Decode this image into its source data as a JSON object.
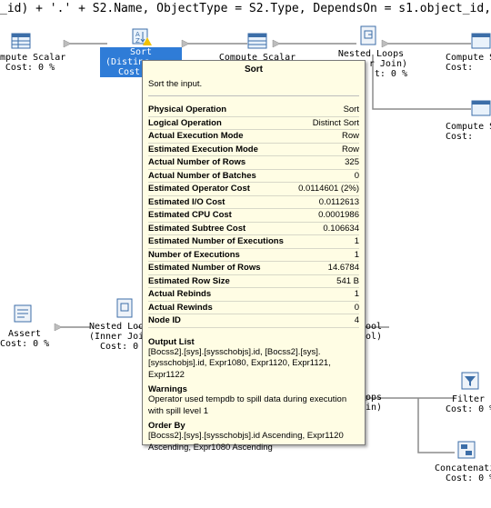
{
  "query_text": "_id) + '.' + S2.Name, ObjectType = S2.Type, DependsOn = s1.object_id, DependsOn",
  "operators": {
    "compute_scalar_left": {
      "name": "Compute Scalar",
      "cost": "Cost: 0 %"
    },
    "sort_selected": {
      "name": "Sort",
      "sub": "(Distinc",
      "cost": "Cost:"
    },
    "compute_scalar_mid": {
      "name": "Compute Scalar"
    },
    "nested_loops_top": {
      "name": "Nested Loops",
      "sub": "r Join)",
      "cost": "t: 0 %"
    },
    "compute_scalar_right1": {
      "name": "Compute S",
      "cost": "Cost:"
    },
    "compute_scalar_right2": {
      "name": "Compute S",
      "cost": "Cost:"
    },
    "assert": {
      "name": "Assert",
      "cost": "Cost: 0 %"
    },
    "nested_loops_mid": {
      "name": "Nested Loo",
      "sub": "(Inner Joi",
      "cost": "Cost: 0 %"
    },
    "spool_right": {
      "name": "ool",
      "sub": "ol)"
    },
    "loops_right": {
      "name": "ops",
      "sub": "in)"
    },
    "filter": {
      "name": "Filter",
      "cost": "Cost: 0 %"
    },
    "concatenation": {
      "name": "Concatenati",
      "cost": "Cost: 0 %"
    }
  },
  "tooltip": {
    "title": "Sort",
    "description": "Sort the input.",
    "properties": [
      {
        "k": "Physical Operation",
        "v": "Sort"
      },
      {
        "k": "Logical Operation",
        "v": "Distinct Sort"
      },
      {
        "k": "Actual Execution Mode",
        "v": "Row"
      },
      {
        "k": "Estimated Execution Mode",
        "v": "Row"
      },
      {
        "k": "Actual Number of Rows",
        "v": "325"
      },
      {
        "k": "Actual Number of Batches",
        "v": "0"
      },
      {
        "k": "Estimated Operator Cost",
        "v": "0.0114601 (2%)"
      },
      {
        "k": "Estimated I/O Cost",
        "v": "0.0112613"
      },
      {
        "k": "Estimated CPU Cost",
        "v": "0.0001986"
      },
      {
        "k": "Estimated Subtree Cost",
        "v": "0.106634"
      },
      {
        "k": "Estimated Number of Executions",
        "v": "1"
      },
      {
        "k": "Number of Executions",
        "v": "1"
      },
      {
        "k": "Estimated Number of Rows",
        "v": "14.6784"
      },
      {
        "k": "Estimated Row Size",
        "v": "541 B"
      },
      {
        "k": "Actual Rebinds",
        "v": "1"
      },
      {
        "k": "Actual Rewinds",
        "v": "0"
      },
      {
        "k": "Node ID",
        "v": "4"
      }
    ],
    "output_list_label": "Output List",
    "output_list": "[Bocss2].[sys].[sysschobjs].id, [Bocss2].[sys].[sysschobjs].id, Expr1080, Expr1120, Expr1121, Expr1122",
    "warnings_label": "Warnings",
    "warnings": "Operator used tempdb to spill data during execution with spill level 1",
    "order_by_label": "Order By",
    "order_by": "[Bocss2].[sys].[sysschobjs].id Ascending, Expr1120 Ascending, Expr1080 Ascending"
  },
  "colors": {
    "selection": "#2f7cd7",
    "tooltip_bg": "#fffde4",
    "warning": "#f2c200"
  }
}
